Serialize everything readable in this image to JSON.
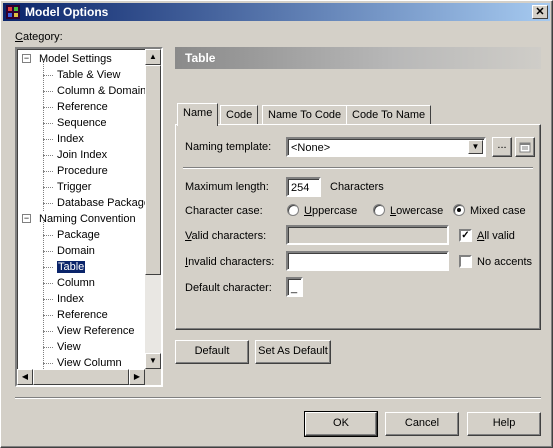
{
  "window": {
    "title": "Model Options",
    "close_glyph": "✕"
  },
  "category": {
    "label": "Category:"
  },
  "tree": {
    "nodes": [
      {
        "label": "Model Settings",
        "level": 0,
        "expander": "−"
      },
      {
        "label": "Table & View",
        "level": 1
      },
      {
        "label": "Column & Domain",
        "level": 1
      },
      {
        "label": "Reference",
        "level": 1
      },
      {
        "label": "Sequence",
        "level": 1
      },
      {
        "label": "Index",
        "level": 1
      },
      {
        "label": "Join Index",
        "level": 1
      },
      {
        "label": "Procedure",
        "level": 1
      },
      {
        "label": "Trigger",
        "level": 1
      },
      {
        "label": "Database Package",
        "level": 1
      },
      {
        "label": "Naming Convention",
        "level": 0,
        "expander": "−"
      },
      {
        "label": "Package",
        "level": 1
      },
      {
        "label": "Domain",
        "level": 1
      },
      {
        "label": "Table",
        "level": 1,
        "selected": true
      },
      {
        "label": "Column",
        "level": 1
      },
      {
        "label": "Index",
        "level": 1
      },
      {
        "label": "Reference",
        "level": 1
      },
      {
        "label": "View Reference",
        "level": 1
      },
      {
        "label": "View",
        "level": 1
      },
      {
        "label": "View Column",
        "level": 1
      }
    ]
  },
  "section": {
    "title": "Table"
  },
  "tabs": [
    {
      "label": "Name",
      "active": true
    },
    {
      "label": "Code"
    },
    {
      "label": "Name To Code"
    },
    {
      "label": "Code To Name"
    }
  ],
  "form": {
    "naming_template_label": "Naming template:",
    "naming_template_value": "<None>",
    "ellipsis_label": "...",
    "max_length_label": "Maximum length:",
    "max_length_value": "254",
    "max_length_unit": "Characters",
    "char_case_label": "Character case:",
    "char_case_options": [
      "Uppercase",
      "Lowercase",
      "Mixed case"
    ],
    "char_case_selected": "Mixed case",
    "valid_chars_label": "Valid characters:",
    "valid_chars_value": "",
    "all_valid_label": "All valid",
    "all_valid_checked": true,
    "invalid_chars_label": "Invalid characters:",
    "invalid_chars_value": "",
    "no_accents_label": "No accents",
    "no_accents_checked": false,
    "default_char_label": "Default character:",
    "default_char_value": "_"
  },
  "buttons": {
    "default": "Default",
    "set_as_default": "Set As Default",
    "ok": "OK",
    "cancel": "Cancel",
    "help": "Help"
  }
}
